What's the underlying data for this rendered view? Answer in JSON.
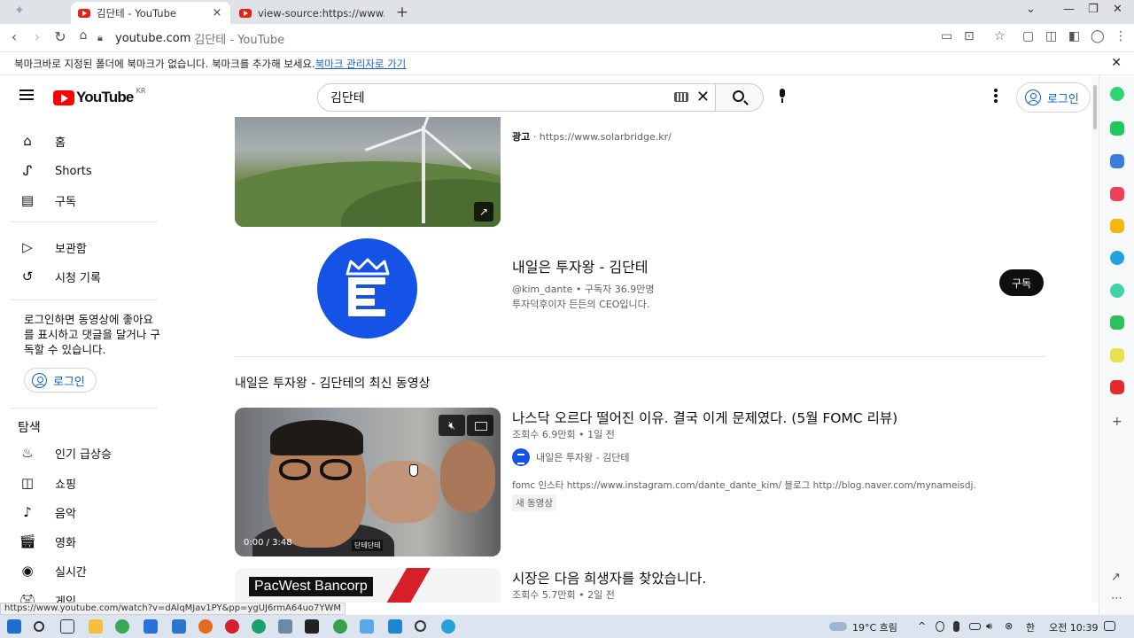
{
  "browser": {
    "tabs": [
      {
        "title": "김단테 - YouTube",
        "active": true
      },
      {
        "title": "view-source:https://www.youtub",
        "active": false
      }
    ],
    "address": {
      "host": "youtube.com",
      "path": "김단테 - YouTube"
    },
    "bookmark_bar": {
      "message": "북마크바로 지정된 폴더에 북마크가 없습니다. 북마크를 추가해 보세요.",
      "link": "북마크 관리자로 가기"
    },
    "status_url": "https://www.youtube.com/watch?v=dAlqMJav1PY&pp=ygUJ6rmA64uo7YWM"
  },
  "youtube": {
    "logo_text": "YouTube",
    "region": "KR",
    "search": {
      "value": "김단테"
    },
    "signin_label": "로그인",
    "guide": {
      "primary": [
        {
          "label": "홈",
          "icon": "home-icon"
        },
        {
          "label": "Shorts",
          "icon": "shorts-icon"
        },
        {
          "label": "구독",
          "icon": "subscriptions-icon"
        }
      ],
      "library": [
        {
          "label": "보관함",
          "icon": "library-icon"
        },
        {
          "label": "시청 기록",
          "icon": "history-icon"
        }
      ],
      "signin_note": "로그인하면 동영상에 좋아요를 표시하고 댓글을 달거나 구독할 수 있습니다.",
      "signin_button": "로그인",
      "explore_heading": "탐색",
      "explore": [
        {
          "label": "인기 급상승",
          "icon": "trending-icon"
        },
        {
          "label": "쇼핑",
          "icon": "shopping-icon"
        },
        {
          "label": "음악",
          "icon": "music-icon"
        },
        {
          "label": "영화",
          "icon": "movies-icon"
        },
        {
          "label": "실시간",
          "icon": "live-icon"
        },
        {
          "label": "게임",
          "icon": "gaming-icon"
        }
      ]
    },
    "ad": {
      "label": "광고",
      "url": "https://www.solarbridge.kr/"
    },
    "channel": {
      "name": "내일은 투자왕 - 김단테",
      "handle": "@kim_dante",
      "subscribers": "구독자 36.9만명",
      "description": "투자덕후이자 든든의 CEO입니다.",
      "subscribe_label": "구독"
    },
    "shelf_title": "내일은 투자왕 - 김단테의 최신 동영상",
    "videos": [
      {
        "title": "나스닥 오르다 떨어진 이유. 결국 이게 문제였다. (5월 FOMC 리뷰)",
        "views": "조회수 6.9만회",
        "age": "1일 전",
        "channel": "내일은 투자왕 - 김단테",
        "description": "fomc 인스타 https://www.instagram.com/dante_dante_kim/ 블로그 http://blog.naver.com/mynameisdj.",
        "badge": "새 동영상",
        "time": "0:00 / 3:48",
        "thumb_tag": "단테단테"
      },
      {
        "title": "시장은 다음 희생자를 찾았습니다.",
        "views": "조회수 5.7만회",
        "age": "2일 전",
        "thumb_label": "PacWest Bancorp"
      }
    ]
  },
  "taskbar": {
    "weather": "19°C 흐림",
    "ime": "한",
    "time": "오전 10:39"
  }
}
